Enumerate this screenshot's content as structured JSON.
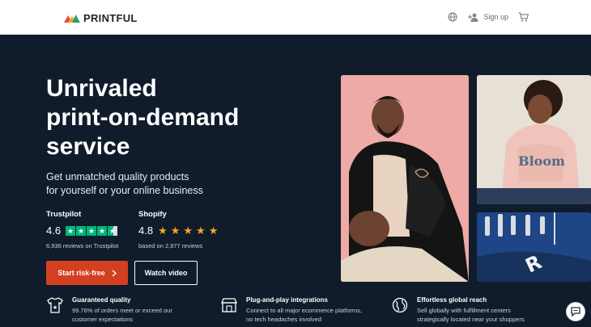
{
  "header": {
    "logo_text": "PRINTFUL",
    "signup_label": "Sign up",
    "icons": [
      "globe-icon",
      "add-user-icon",
      "cart-icon"
    ]
  },
  "hero": {
    "headline_lines": [
      "Unrivaled",
      "print-on-demand",
      "service"
    ],
    "subhead_lines": [
      "Get unmatched quality products",
      "for yourself or your online business"
    ]
  },
  "ratings": {
    "trustpilot": {
      "brand": "Trustpilot",
      "score": "4.6",
      "reviews": "6,936 reviews on Trustpilot",
      "stars": 4.6
    },
    "shopify": {
      "brand": "Shopify",
      "score": "4.8",
      "reviews": "based on 2,977 reviews",
      "stars": 4.8
    }
  },
  "cta": {
    "primary_label": "Start risk-free",
    "secondary_label": "Watch video"
  },
  "features": [
    {
      "title": "Guaranteed quality",
      "line1": "99.76% of orders meet or exceed our",
      "line2": "customer expectations",
      "icon": "shirt-star-icon"
    },
    {
      "title": "Plug-and-play integrations",
      "line1": "Connect to all major ecommerce platforms,",
      "line2": "no tech headaches involved",
      "icon": "storefront-icon"
    },
    {
      "title": "Effortless global reach",
      "line1": "Sell globally with fulfillment centers",
      "line2": "strategically located near your shoppers",
      "icon": "globe-icon"
    }
  ],
  "colors": {
    "hero_bg": "#101c2b",
    "primary_button": "#d2401f",
    "trustpilot_green": "#00b67a",
    "star_orange": "#f5a623"
  }
}
